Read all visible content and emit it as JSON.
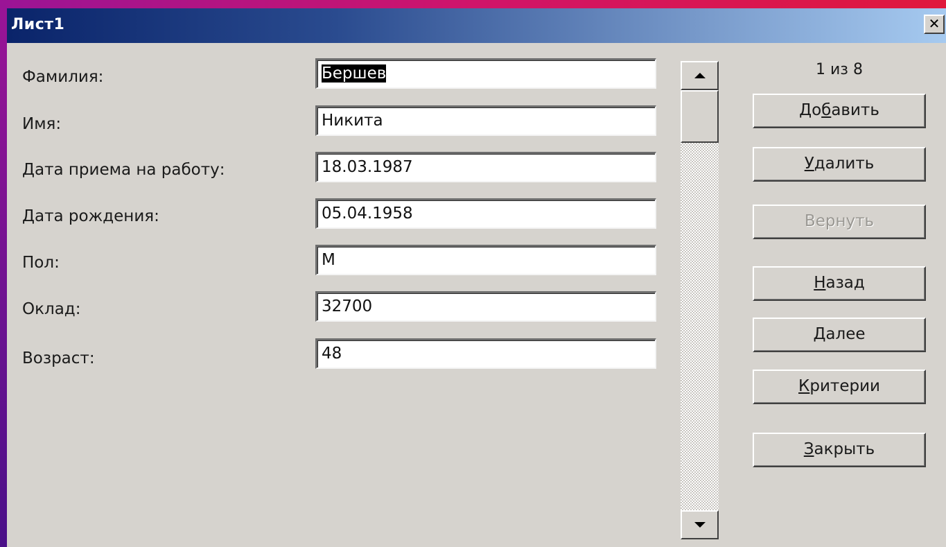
{
  "window": {
    "title": "Лист1",
    "close_glyph": "✕"
  },
  "fields": [
    {
      "label": "Фамилия:",
      "value": "Бершев"
    },
    {
      "label": "Имя:",
      "value": "Никита"
    },
    {
      "label": "Дата приема на работу:",
      "value": "18.03.1987"
    },
    {
      "label": "Дата рождения:",
      "value": "05.04.1958"
    },
    {
      "label": "Пол:",
      "value": "М"
    },
    {
      "label": "Оклад:",
      "value": "32700"
    },
    {
      "label": "Возраст:",
      "value": "48"
    }
  ],
  "record_counter": "1 из 8",
  "buttons": {
    "add": {
      "pre": "До",
      "ul": "б",
      "post": "авить"
    },
    "delete": {
      "pre": "",
      "ul": "У",
      "post": "далить"
    },
    "restore": {
      "pre": "",
      "ul": "",
      "post": "Вернуть"
    },
    "back": {
      "pre": "",
      "ul": "Н",
      "post": "азад"
    },
    "next": {
      "pre": "",
      "ul": "Д",
      "post": "алее"
    },
    "criteria": {
      "pre": "",
      "ul": "К",
      "post": "ритерии"
    },
    "close": {
      "pre": "",
      "ul": "З",
      "post": "акрыть"
    }
  },
  "scrollbar": {
    "up_icon": "arrow-up-icon",
    "down_icon": "arrow-down-icon"
  },
  "colors": {
    "dialog": "#d6d3ce",
    "title_start": "#0a246a",
    "title_end": "#a6caf0"
  }
}
